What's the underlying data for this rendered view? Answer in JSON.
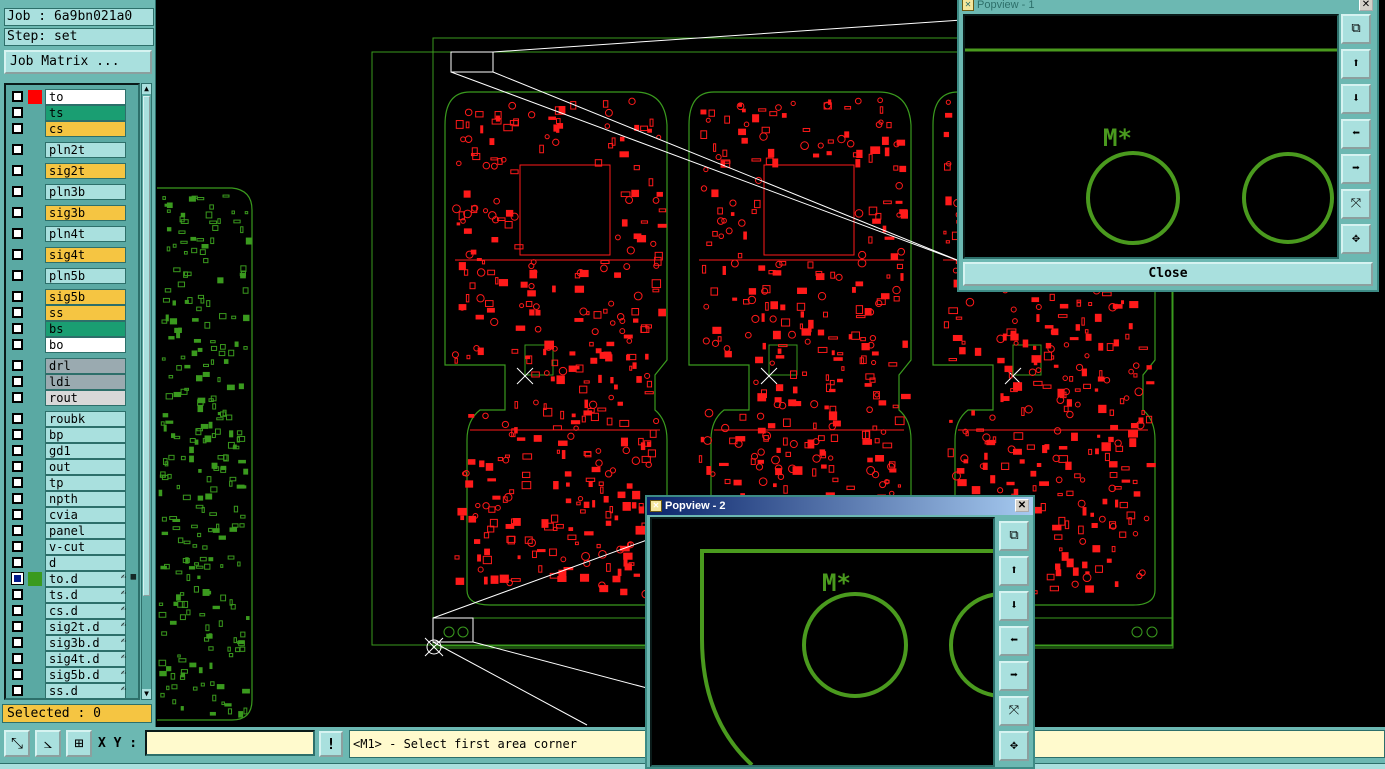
{
  "left_panel": {
    "job_line": "Job : 6a9bn021a0",
    "step_line": "Step: set",
    "job_matrix_label": "Job Matrix ...",
    "layers": [
      {
        "name": "to",
        "bg": "#ffffff",
        "swatch": "#ff0000",
        "checked": false,
        "flag": ""
      },
      {
        "name": "ts",
        "bg": "#1a9e72",
        "swatch": "",
        "checked": false,
        "flag": ""
      },
      {
        "name": "cs",
        "bg": "#f5c542",
        "swatch": "",
        "checked": false,
        "flag": ""
      },
      {
        "name": "pln2t",
        "bg": "#a9e0de",
        "swatch": "",
        "checked": false,
        "flag": ""
      },
      {
        "name": "sig2t",
        "bg": "#f5c542",
        "swatch": "",
        "checked": false,
        "flag": ""
      },
      {
        "name": "pln3b",
        "bg": "#a9e0de",
        "swatch": "",
        "checked": false,
        "flag": ""
      },
      {
        "name": "sig3b",
        "bg": "#f5c542",
        "swatch": "",
        "checked": false,
        "flag": ""
      },
      {
        "name": "pln4t",
        "bg": "#a9e0de",
        "swatch": "",
        "checked": false,
        "flag": ""
      },
      {
        "name": "sig4t",
        "bg": "#f5c542",
        "swatch": "",
        "checked": false,
        "flag": ""
      },
      {
        "name": "pln5b",
        "bg": "#a9e0de",
        "swatch": "",
        "checked": false,
        "flag": ""
      },
      {
        "name": "sig5b",
        "bg": "#f5c542",
        "swatch": "",
        "checked": false,
        "flag": ""
      },
      {
        "name": "ss",
        "bg": "#f5c542",
        "swatch": "",
        "checked": false,
        "flag": ""
      },
      {
        "name": "bs",
        "bg": "#1a9e72",
        "swatch": "",
        "checked": false,
        "flag": ""
      },
      {
        "name": "bo",
        "bg": "#ffffff",
        "swatch": "",
        "checked": false,
        "flag": ""
      },
      {
        "name": "drl",
        "bg": "#9aaab0",
        "swatch": "",
        "checked": false,
        "flag": ""
      },
      {
        "name": "ldi",
        "bg": "#9aaab0",
        "swatch": "",
        "checked": false,
        "flag": ""
      },
      {
        "name": "rout",
        "bg": "#d8d8d8",
        "swatch": "",
        "checked": false,
        "flag": ""
      },
      {
        "name": "roubk",
        "bg": "#a9e0de",
        "swatch": "",
        "checked": false,
        "flag": ""
      },
      {
        "name": "bp",
        "bg": "#a9e0de",
        "swatch": "",
        "checked": false,
        "flag": ""
      },
      {
        "name": "gd1",
        "bg": "#a9e0de",
        "swatch": "",
        "checked": false,
        "flag": ""
      },
      {
        "name": "out",
        "bg": "#a9e0de",
        "swatch": "",
        "checked": false,
        "flag": ""
      },
      {
        "name": "tp",
        "bg": "#a9e0de",
        "swatch": "",
        "checked": false,
        "flag": ""
      },
      {
        "name": "npth",
        "bg": "#a9e0de",
        "swatch": "",
        "checked": false,
        "flag": ""
      },
      {
        "name": "cvia",
        "bg": "#a9e0de",
        "swatch": "",
        "checked": false,
        "flag": ""
      },
      {
        "name": "panel",
        "bg": "#a9e0de",
        "swatch": "",
        "checked": false,
        "flag": ""
      },
      {
        "name": "v-cut",
        "bg": "#a9e0de",
        "swatch": "",
        "checked": false,
        "flag": ""
      },
      {
        "name": "d",
        "bg": "#a9e0de",
        "swatch": "",
        "checked": false,
        "flag": ""
      },
      {
        "name": "to.d",
        "bg": "#a9e0de",
        "swatch": "#3a9a1e",
        "checked": true,
        "flag": "✍",
        "flag2": "▦"
      },
      {
        "name": "ts.d",
        "bg": "#a9e0de",
        "swatch": "",
        "checked": false,
        "flag": "✍"
      },
      {
        "name": "cs.d",
        "bg": "#a9e0de",
        "swatch": "",
        "checked": false,
        "flag": "✍"
      },
      {
        "name": "sig2t.d",
        "bg": "#a9e0de",
        "swatch": "",
        "checked": false,
        "flag": "✍"
      },
      {
        "name": "sig3b.d",
        "bg": "#a9e0de",
        "swatch": "",
        "checked": false,
        "flag": "✍"
      },
      {
        "name": "sig4t.d",
        "bg": "#a9e0de",
        "swatch": "",
        "checked": false,
        "flag": "✍"
      },
      {
        "name": "sig5b.d",
        "bg": "#a9e0de",
        "swatch": "",
        "checked": false,
        "flag": "✍"
      },
      {
        "name": "ss.d",
        "bg": "#a9e0de",
        "swatch": "",
        "checked": false,
        "flag": "✍"
      }
    ],
    "selected_text": "Selected : 0"
  },
  "bottom_bar": {
    "xy_label": "X Y :",
    "xy_value": "",
    "warn_label": "!",
    "prompt_text": "<M1> - Select first area corner",
    "tools": [
      "zoom-area-icon",
      "measure-icon",
      "grid-snap-icon"
    ]
  },
  "popview1": {
    "title": "Popview - 1",
    "label": "M*",
    "close_label": "Close",
    "tools": [
      "fit-icon",
      "pan-up-icon",
      "pan-down-icon",
      "pan-left-icon",
      "pan-right-icon",
      "zoom-in-icon",
      "zoom-out-icon"
    ]
  },
  "popview2": {
    "title": "Popview - 2",
    "label": "M*",
    "tools": [
      "fit-icon",
      "pan-up-icon",
      "pan-down-icon",
      "pan-left-icon",
      "pan-right-icon",
      "zoom-in-icon",
      "zoom-out-icon"
    ]
  },
  "colors": {
    "panel": "#6cb8b2",
    "board_outline": "#3a9a1e",
    "copper": "#ff1a1a",
    "prompt_bg": "#fffacd"
  }
}
